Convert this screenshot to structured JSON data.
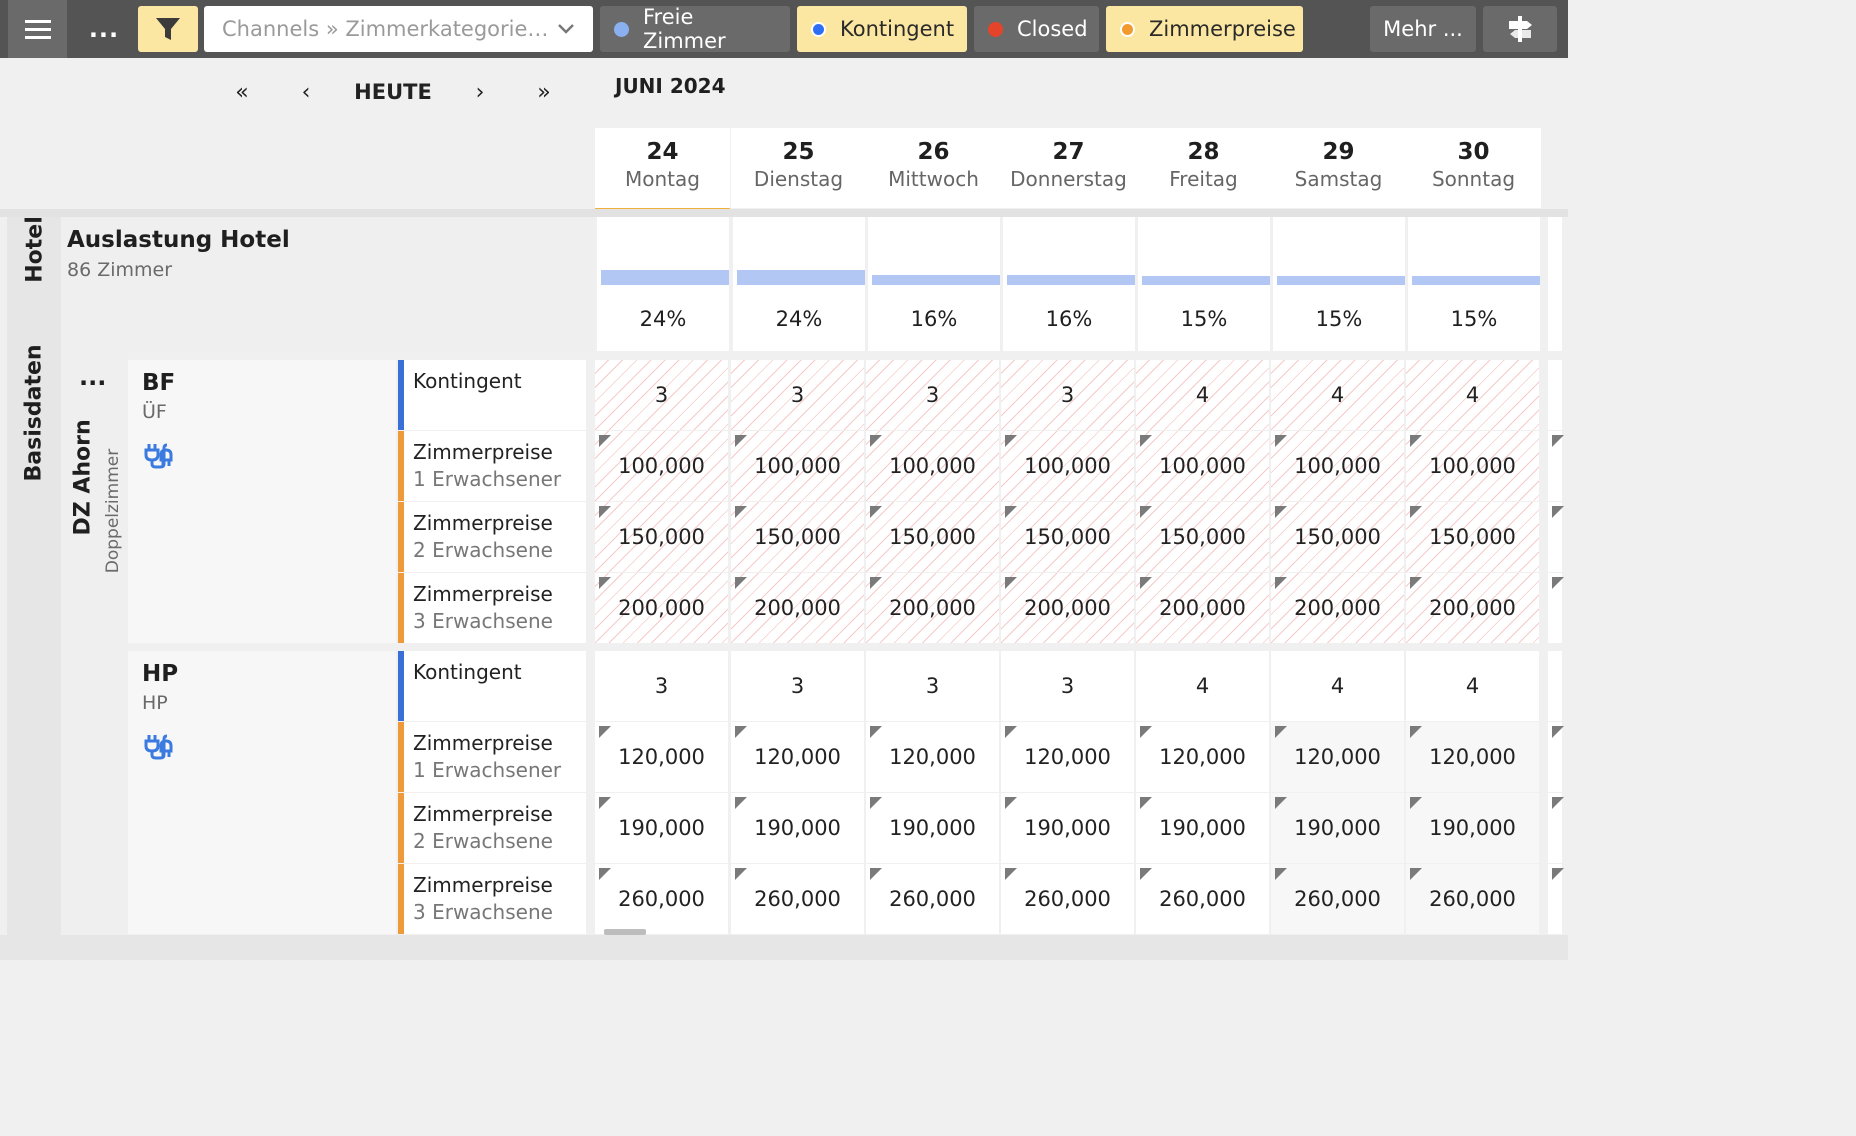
{
  "toolbar": {
    "more_label": "...",
    "channel_select": "Channels » Zimmerkategorie…",
    "legend": [
      {
        "label": "Freie Zimmer",
        "color": "#8ab0f0",
        "active": false
      },
      {
        "label": "Kontingent",
        "color": "#2e6ef5",
        "active": true
      },
      {
        "label": "Closed",
        "color": "#e5442b",
        "active": false
      },
      {
        "label": "Zimmerpreise",
        "color": "#f29a2e",
        "active": true
      }
    ],
    "mehr_label": "Mehr ...",
    "icons": {
      "menu": "hamburger-icon",
      "filter": "filter-icon",
      "dropdown": "chevron-down-icon",
      "exit": "signpost-exit-icon"
    }
  },
  "nav": {
    "first": "«",
    "prev": "‹",
    "today": "HEUTE",
    "next": "›",
    "last": "»",
    "month": "JUNI 2024"
  },
  "days": [
    {
      "num": "24",
      "weekday": "Montag",
      "today": true
    },
    {
      "num": "25",
      "weekday": "Dienstag"
    },
    {
      "num": "26",
      "weekday": "Mittwoch"
    },
    {
      "num": "27",
      "weekday": "Donnerstag"
    },
    {
      "num": "28",
      "weekday": "Freitag"
    },
    {
      "num": "29",
      "weekday": "Samstag"
    },
    {
      "num": "30",
      "weekday": "Sonntag"
    }
  ],
  "hotel": {
    "section_label": "Hotel",
    "title": "Auslastung Hotel",
    "subtitle": "86 Zimmer",
    "occupancy": [
      {
        "label": "24%",
        "value": 0.24
      },
      {
        "label": "24%",
        "value": 0.24
      },
      {
        "label": "16%",
        "value": 0.16
      },
      {
        "label": "16%",
        "value": 0.16
      },
      {
        "label": "15%",
        "value": 0.15
      },
      {
        "label": "15%",
        "value": 0.15
      },
      {
        "label": "15%",
        "value": 0.15
      }
    ]
  },
  "basis": {
    "section_label": "Basisdaten",
    "room": {
      "name": "DZ Ahorn",
      "type": "Doppelzimmer",
      "menu": "..."
    },
    "rates": [
      {
        "code": "BF",
        "sub": "ÜF",
        "icon": "channel-plug-icon",
        "closed": true,
        "rows": [
          {
            "label": "Kontingent",
            "sub": "",
            "stripe": "#3a6fd8",
            "triangle": false,
            "values": [
              "3",
              "3",
              "3",
              "3",
              "4",
              "4",
              "4"
            ]
          },
          {
            "label": "Zimmerpreise",
            "sub": "1 Erwachsener",
            "stripe": "#ef9a3a",
            "triangle": true,
            "values": [
              "100,000",
              "100,000",
              "100,000",
              "100,000",
              "100,000",
              "100,000",
              "100,000"
            ]
          },
          {
            "label": "Zimmerpreise",
            "sub": "2 Erwachsene",
            "stripe": "#ef9a3a",
            "triangle": true,
            "values": [
              "150,000",
              "150,000",
              "150,000",
              "150,000",
              "150,000",
              "150,000",
              "150,000"
            ]
          },
          {
            "label": "Zimmerpreise",
            "sub": "3 Erwachsene",
            "stripe": "#ef9a3a",
            "triangle": true,
            "values": [
              "200,000",
              "200,000",
              "200,000",
              "200,000",
              "200,000",
              "200,000",
              "200,000"
            ]
          }
        ]
      },
      {
        "code": "HP",
        "sub": "HP",
        "icon": "channel-plug-icon",
        "closed": false,
        "rows": [
          {
            "label": "Kontingent",
            "sub": "",
            "stripe": "#3a6fd8",
            "triangle": false,
            "values": [
              "3",
              "3",
              "3",
              "3",
              "4",
              "4",
              "4"
            ]
          },
          {
            "label": "Zimmerpreise",
            "sub": "1 Erwachsener",
            "stripe": "#ef9a3a",
            "triangle": true,
            "values": [
              "120,000",
              "120,000",
              "120,000",
              "120,000",
              "120,000",
              "120,000",
              "120,000"
            ]
          },
          {
            "label": "Zimmerpreise",
            "sub": "2 Erwachsene",
            "stripe": "#ef9a3a",
            "triangle": true,
            "values": [
              "190,000",
              "190,000",
              "190,000",
              "190,000",
              "190,000",
              "190,000",
              "190,000"
            ]
          },
          {
            "label": "Zimmerpreise",
            "sub": "3 Erwachsene",
            "stripe": "#ef9a3a",
            "triangle": true,
            "values": [
              "260,000",
              "260,000",
              "260,000",
              "260,000",
              "260,000",
              "260,000",
              "260,000"
            ]
          }
        ]
      }
    ]
  }
}
